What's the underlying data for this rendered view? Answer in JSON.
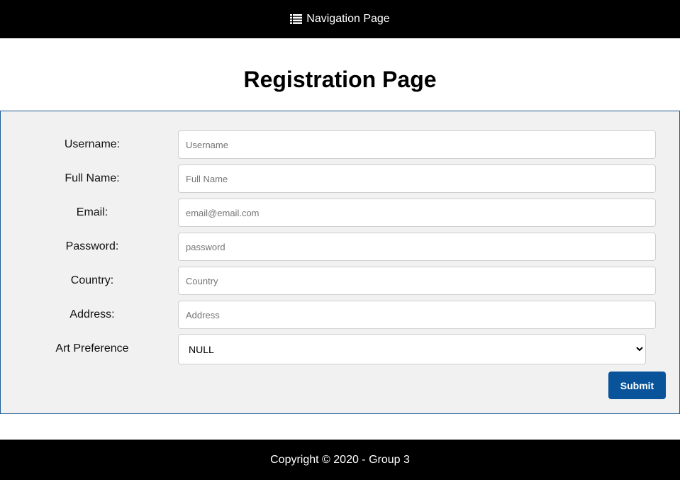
{
  "header": {
    "nav_label": "Navigation Page",
    "nav_icon": "list-icon"
  },
  "page": {
    "title": "Registration Page"
  },
  "form": {
    "fields": [
      {
        "label": "Username:",
        "placeholder": "Username",
        "value": ""
      },
      {
        "label": "Full Name:",
        "placeholder": "Full Name",
        "value": ""
      },
      {
        "label": "Email:",
        "placeholder": "email@email.com",
        "value": ""
      },
      {
        "label": "Password:",
        "placeholder": "password",
        "value": ""
      },
      {
        "label": "Country:",
        "placeholder": "Country",
        "value": ""
      },
      {
        "label": "Address:",
        "placeholder": "Address",
        "value": ""
      }
    ],
    "art_preference": {
      "label": "Art Preference",
      "selected": "NULL"
    },
    "submit_label": "Submit"
  },
  "footer": {
    "text": "Copyright © 2020 - Group 3"
  },
  "colors": {
    "header_bg": "#000000",
    "panel_bg": "#f1f1f1",
    "panel_border": "#1f5b96",
    "button_bg": "#08539a",
    "footer_bg": "#000000"
  }
}
